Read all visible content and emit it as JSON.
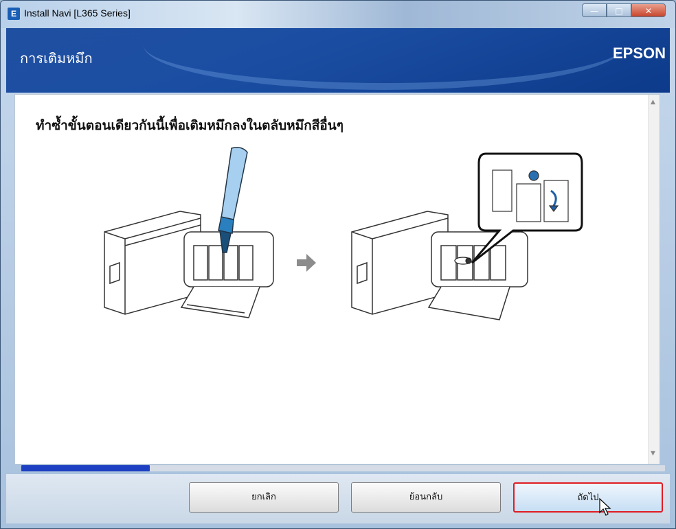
{
  "window": {
    "title": "Install Navi [L365 Series]",
    "icon_letter": "E"
  },
  "header": {
    "title": "การเติมหมึก",
    "brand": "EPSON"
  },
  "content": {
    "instruction": "ทำซ้ำขั้นตอนเดียวกันนี้เพื่อเติมหมึกลงในตลับหมึกสีอื่นๆ"
  },
  "progress": {
    "value": 0.2
  },
  "footer": {
    "cancel_label": "ยกเลิก",
    "back_label": "ย้อนกลับ",
    "next_label": "ถัดไป"
  },
  "colors": {
    "header_blue": "#1b4ea3",
    "progress_blue": "#1d3fc2",
    "highlight_red": "#e01b22",
    "ink_bottle": "#9ec9e8"
  }
}
